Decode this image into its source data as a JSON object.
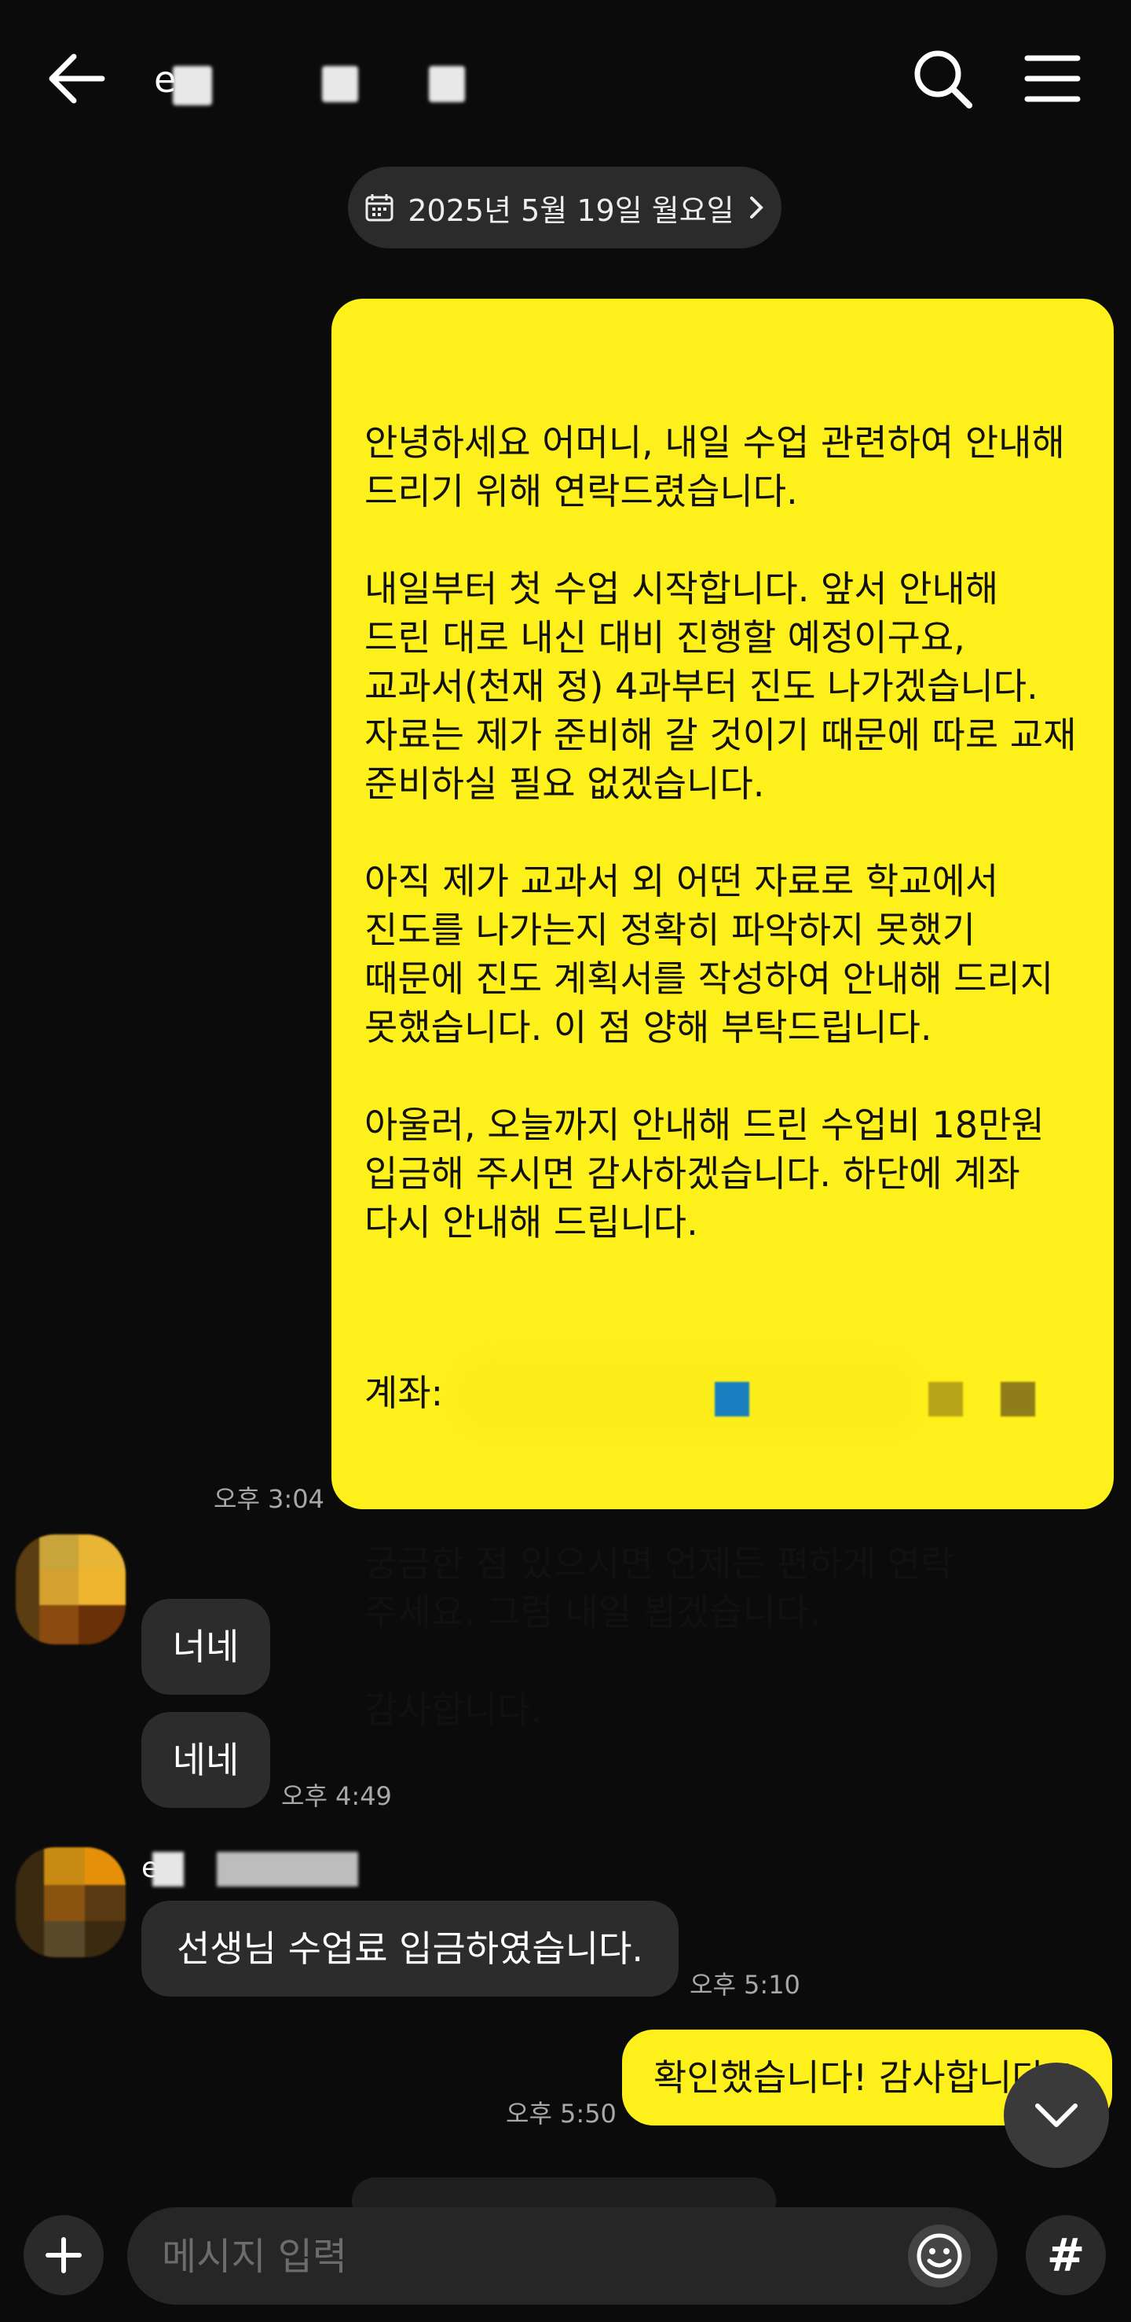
{
  "header": {
    "back_icon": "arrow-left-icon",
    "search_icon": "search-icon",
    "menu_icon": "hamburger-menu-icon",
    "title_visible": "e"
  },
  "date_divider": {
    "icon": "calendar-icon",
    "label": "2025년 5월 19일 월요일",
    "chevron": "chevron-right-icon"
  },
  "messages": [
    {
      "side": "me",
      "time": "오후 3:04",
      "text": "안녕하세요 어머니, 내일 수업 관련하여 안내해\n드리기 위해 연락드렸습니다.\n\n내일부터 첫 수업 시작합니다. 앞서 안내해\n드린 대로 내신 대비 진행할 예정이구요,\n교과서(천재 정) 4과부터 진도 나가겠습니다.\n자료는 제가 준비해 갈 것이기 때문에 따로 교재\n준비하실 필요 없겠습니다.\n\n아직 제가 교과서 외 어떤 자료로 학교에서\n진도를 나가는지 정확히 파악하지 못했기\n때문에 진도 계획서를 작성하여 안내해 드리지\n못했습니다. 이 점 양해 부탁드립니다.\n\n아울러, 오늘까지 안내해 드린 수업비 18만원\n입금해 주시면 감사하겠습니다. 하단에 계좌\n다시 안내해 드립니다.",
      "account_label": "계좌:",
      "text_after": "궁금한 점 있으시면 언제든 편하게 연락\n주세요. 그럼 내일 뵙겠습니다.\n\n감사합니다."
    },
    {
      "side": "other",
      "sender_visible": "",
      "bubbles": [
        "너네",
        "네네"
      ],
      "time": "오후 4:49"
    },
    {
      "side": "other",
      "sender_visible": "e",
      "bubbles": [
        "선생님 수업료 입금하였습니다."
      ],
      "time": "오후 5:10"
    },
    {
      "side": "me",
      "time": "오후 5:50",
      "text": "확인했습니다! 감사합니다!!"
    }
  ],
  "scroll_button_icon": "chevron-down-icon",
  "input_bar": {
    "plus_icon": "plus-icon",
    "placeholder": "메시지 입력",
    "emoji_icon": "smiley-icon",
    "hash_label": "#"
  },
  "colors": {
    "background": "#0b0b0b",
    "my_bubble": "#fef01b",
    "other_bubble": "#2c2c2c",
    "timestamp": "#a8a8a8"
  }
}
